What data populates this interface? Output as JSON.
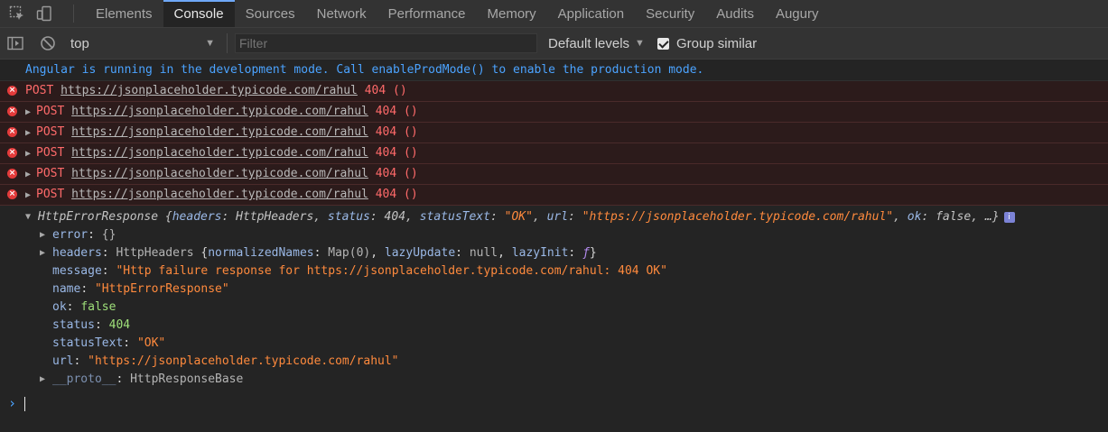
{
  "tabs": {
    "items": [
      "Elements",
      "Console",
      "Sources",
      "Network",
      "Performance",
      "Memory",
      "Application",
      "Security",
      "Audits",
      "Augury"
    ],
    "active": "Console"
  },
  "toolbar": {
    "context": "top",
    "filter_placeholder": "Filter",
    "levels": "Default levels",
    "group_similar": "Group similar",
    "group_similar_checked": true
  },
  "console": {
    "info": "Angular is running in the development mode. Call enableProdMode() to enable the production mode.",
    "errors": [
      {
        "method": "POST",
        "url": "https://jsonplaceholder.typicode.com/rahul",
        "status": "404 ()"
      },
      {
        "method": "POST",
        "url": "https://jsonplaceholder.typicode.com/rahul",
        "status": "404 ()"
      },
      {
        "method": "POST",
        "url": "https://jsonplaceholder.typicode.com/rahul",
        "status": "404 ()"
      },
      {
        "method": "POST",
        "url": "https://jsonplaceholder.typicode.com/rahul",
        "status": "404 ()"
      },
      {
        "method": "POST",
        "url": "https://jsonplaceholder.typicode.com/rahul",
        "status": "404 ()"
      },
      {
        "method": "POST",
        "url": "https://jsonplaceholder.typicode.com/rahul",
        "status": "404 ()"
      }
    ],
    "object": {
      "type": "HttpErrorResponse",
      "summary": {
        "headers_key": "headers",
        "headers_val": "HttpHeaders",
        "status_key": "status",
        "status_val": "404",
        "statusText_key": "statusText",
        "statusText_val": "\"OK\"",
        "url_key": "url",
        "url_val": "\"https://jsonplaceholder.typicode.com/rahul\"",
        "ok_key": "ok",
        "ok_val": "false",
        "ellipsis": "…}"
      },
      "props": {
        "error_key": "error",
        "error_val": "{}",
        "headers_key": "headers",
        "headers_type": "HttpHeaders",
        "normalizedNames_key": "normalizedNames",
        "normalizedNames_val": "Map(0)",
        "lazyUpdate_key": "lazyUpdate",
        "lazyUpdate_val": "null",
        "lazyInit_key": "lazyInit",
        "lazyInit_val": "ƒ",
        "message_key": "message",
        "message_val": "\"Http failure response for https://jsonplaceholder.typicode.com/rahul: 404 OK\"",
        "name_key": "name",
        "name_val": "\"HttpErrorResponse\"",
        "ok_key": "ok",
        "ok_val": "false",
        "status_key": "status",
        "status_val": "404",
        "statusText_key": "statusText",
        "statusText_val": "\"OK\"",
        "url_key": "url",
        "url_val": "\"https://jsonplaceholder.typicode.com/rahul\"",
        "proto_key": "__proto__",
        "proto_val": "HttpResponseBase"
      }
    }
  },
  "icons": {
    "inspect": "inspect-element-icon",
    "device": "device-toolbar-icon",
    "sidebar": "console-sidebar-icon",
    "clear": "clear-console-icon"
  },
  "colors": {
    "accent": "#6ea7f7",
    "error_text": "#ff6a6a",
    "info_text": "#4ba3ff",
    "string": "#ff8a3d"
  }
}
